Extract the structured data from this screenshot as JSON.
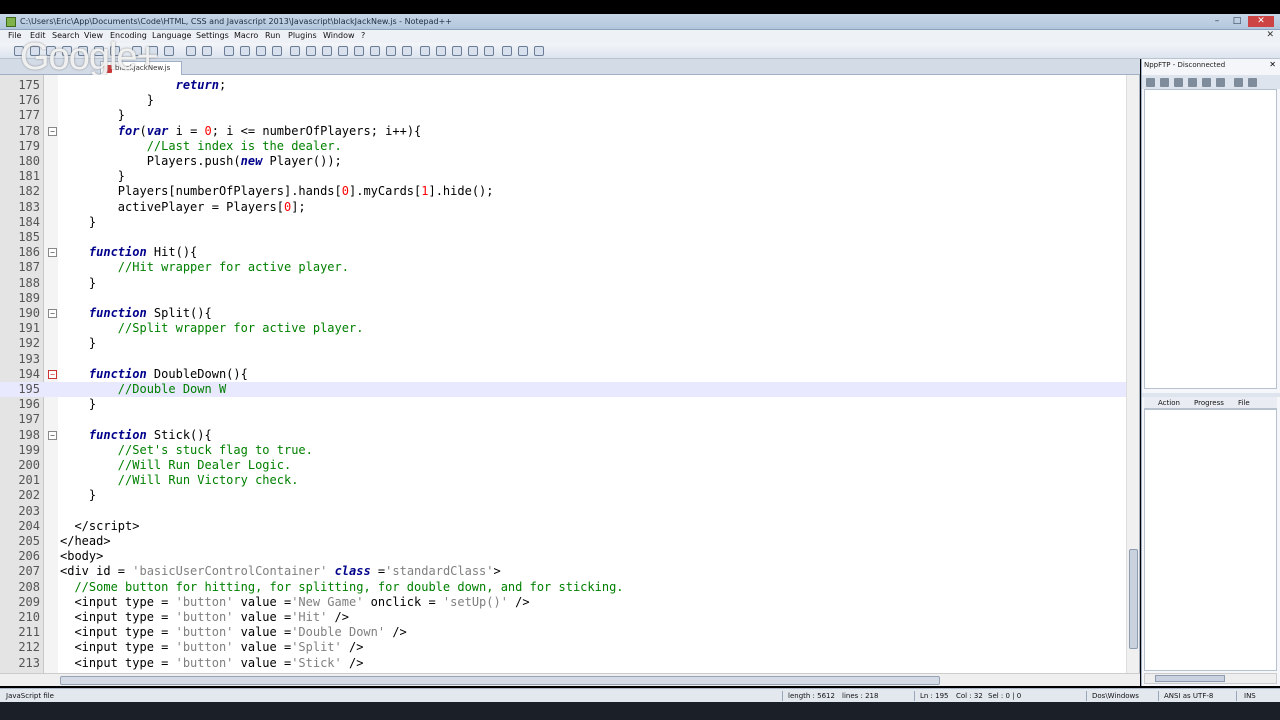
{
  "window": {
    "title": "C:\\Users\\Eric\\App\\Documents\\Code\\HTML, CSS and Javascript 2013\\Javascript\\blackJackNew.js - Notepad++"
  },
  "watermark": "Google+",
  "menu": [
    "File",
    "Edit",
    "Search",
    "View",
    "Encoding",
    "Language",
    "Settings",
    "Macro",
    "Run",
    "Plugins",
    "Window",
    "?"
  ],
  "tab": {
    "label": "blackJackNew.js"
  },
  "editor": {
    "current_line": 195,
    "lines": [
      {
        "n": 175,
        "fold": "",
        "html": "                <span class=\"kw\">return</span>;"
      },
      {
        "n": 176,
        "fold": "",
        "html": "            }"
      },
      {
        "n": 177,
        "fold": "",
        "html": "        }"
      },
      {
        "n": 178,
        "fold": "minus",
        "html": "        <span class=\"kw\">for</span>(<span class=\"kw\">var</span> i = <span class=\"num\">0</span>; i &lt;= numberOfPlayers; i++){"
      },
      {
        "n": 179,
        "fold": "",
        "html": "            <span class=\"cm\">//Last index is the dealer.</span>"
      },
      {
        "n": 180,
        "fold": "",
        "html": "            Players.push(<span class=\"kw\">new</span> Player());"
      },
      {
        "n": 181,
        "fold": "",
        "html": "        }"
      },
      {
        "n": 182,
        "fold": "",
        "html": "        Players[numberOfPlayers].hands[<span class=\"num\">0</span>].myCards[<span class=\"num\">1</span>].hide();"
      },
      {
        "n": 183,
        "fold": "",
        "html": "        activePlayer = Players[<span class=\"num\">0</span>];"
      },
      {
        "n": 184,
        "fold": "",
        "html": "    }"
      },
      {
        "n": 185,
        "fold": "",
        "html": ""
      },
      {
        "n": 186,
        "fold": "minus",
        "html": "    <span class=\"kw\">function</span> Hit(){"
      },
      {
        "n": 187,
        "fold": "",
        "html": "        <span class=\"cm\">//Hit wrapper for active player.</span>"
      },
      {
        "n": 188,
        "fold": "",
        "html": "    }"
      },
      {
        "n": 189,
        "fold": "",
        "html": ""
      },
      {
        "n": 190,
        "fold": "minus",
        "html": "    <span class=\"kw\">function</span> Split(){"
      },
      {
        "n": 191,
        "fold": "",
        "html": "        <span class=\"cm\">//Split wrapper for active player.</span>"
      },
      {
        "n": 192,
        "fold": "",
        "html": "    }"
      },
      {
        "n": 193,
        "fold": "",
        "html": ""
      },
      {
        "n": 194,
        "fold": "red",
        "html": "    <span class=\"kw\">function</span> DoubleDown(){"
      },
      {
        "n": 195,
        "fold": "",
        "html": "        <span class=\"cm\">//Double Down W</span>"
      },
      {
        "n": 196,
        "fold": "",
        "html": "    }"
      },
      {
        "n": 197,
        "fold": "",
        "html": ""
      },
      {
        "n": 198,
        "fold": "minus",
        "html": "    <span class=\"kw\">function</span> Stick(){"
      },
      {
        "n": 199,
        "fold": "",
        "html": "        <span class=\"cm\">//Set's stuck flag to true.</span>"
      },
      {
        "n": 200,
        "fold": "",
        "html": "        <span class=\"cm\">//Will Run Dealer Logic.</span>"
      },
      {
        "n": 201,
        "fold": "",
        "html": "        <span class=\"cm\">//Will Run Victory check.</span>"
      },
      {
        "n": 202,
        "fold": "",
        "html": "    }"
      },
      {
        "n": 203,
        "fold": "",
        "html": ""
      },
      {
        "n": 204,
        "fold": "",
        "html": "  &lt;/script&gt;"
      },
      {
        "n": 205,
        "fold": "",
        "html": "&lt;/head&gt;"
      },
      {
        "n": 206,
        "fold": "",
        "html": "&lt;body&gt;"
      },
      {
        "n": 207,
        "fold": "",
        "html": "&lt;div id = <span class=\"str\">'basicUserControlContainer'</span> <span class=\"kw\">class</span> =<span class=\"str\">'standardClass'</span>&gt;"
      },
      {
        "n": 208,
        "fold": "",
        "html": "  <span class=\"cm\">//Some button for hitting, for splitting, for double down, and for sticking.</span>"
      },
      {
        "n": 209,
        "fold": "",
        "html": "  &lt;input type = <span class=\"str\">'button'</span> value =<span class=\"str\">'New Game'</span> onclick = <span class=\"str\">'setUp()'</span> /&gt;"
      },
      {
        "n": 210,
        "fold": "",
        "html": "  &lt;input type = <span class=\"str\">'button'</span> value =<span class=\"str\">'Hit'</span> /&gt;"
      },
      {
        "n": 211,
        "fold": "",
        "html": "  &lt;input type = <span class=\"str\">'button'</span> value =<span class=\"str\">'Double Down'</span> /&gt;"
      },
      {
        "n": 212,
        "fold": "",
        "html": "  &lt;input type = <span class=\"str\">'button'</span> value =<span class=\"str\">'Split'</span> /&gt;"
      },
      {
        "n": 213,
        "fold": "",
        "html": "  &lt;input type = <span class=\"str\">'button'</span> value =<span class=\"str\">'Stick'</span> /&gt;"
      }
    ]
  },
  "ftp_panel": {
    "title": "NppFTP - Disconnected",
    "tabs": [
      "Action",
      "Progress",
      "File"
    ]
  },
  "status": {
    "file_type": "JavaScript file",
    "length": "length : 5612",
    "lines": "lines : 218",
    "position": "Ln : 195",
    "col": "Col : 32",
    "sel": "Sel : 0 | 0",
    "eol": "Dos\\Windows",
    "encoding": "ANSI as UTF-8",
    "mode": "INS"
  },
  "colors": {
    "keyword": "#00008b",
    "comment": "#008000",
    "string": "#808080",
    "number": "#ff0000",
    "current_line": "#e8e8ff"
  }
}
